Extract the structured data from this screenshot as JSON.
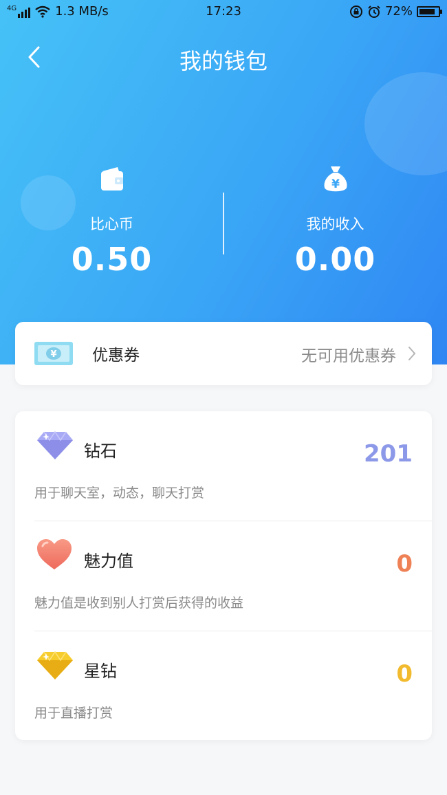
{
  "status_bar": {
    "network_type": "4G",
    "speed": "1.3 MB/s",
    "time": "17:23",
    "battery": "72%",
    "icons": [
      "signal-icon",
      "wifi-icon",
      "rotation-lock-icon",
      "alarm-icon",
      "battery-icon"
    ]
  },
  "header": {
    "title": "我的钱包",
    "back_icon": "back-chevron-icon"
  },
  "balances": {
    "coins": {
      "label": "比心币",
      "value": "0.50",
      "icon": "wallet-icon"
    },
    "income": {
      "label": "我的收入",
      "value": "0.00",
      "icon": "money-bag-icon"
    }
  },
  "coupon": {
    "label": "优惠券",
    "status": "无可用优惠券",
    "icon": "banknote-icon"
  },
  "assets": [
    {
      "name": "钻石",
      "desc": "用于聊天室，动态，聊天打赏",
      "value": "201",
      "color": "#8c98e8",
      "icon": "purple-diamond-icon"
    },
    {
      "name": "魅力值",
      "desc": "魅力值是收到别人打赏后获得的收益",
      "value": "0",
      "color": "#ef8156",
      "icon": "heart-icon"
    },
    {
      "name": "星钻",
      "desc": "用于直播打赏",
      "value": "0",
      "color": "#f2bb2f",
      "icon": "gold-diamond-icon"
    }
  ],
  "colors": {
    "header_gradient_start": "#46c2f7",
    "header_gradient_end": "#2f86f3",
    "background": "#f6f7f9"
  }
}
